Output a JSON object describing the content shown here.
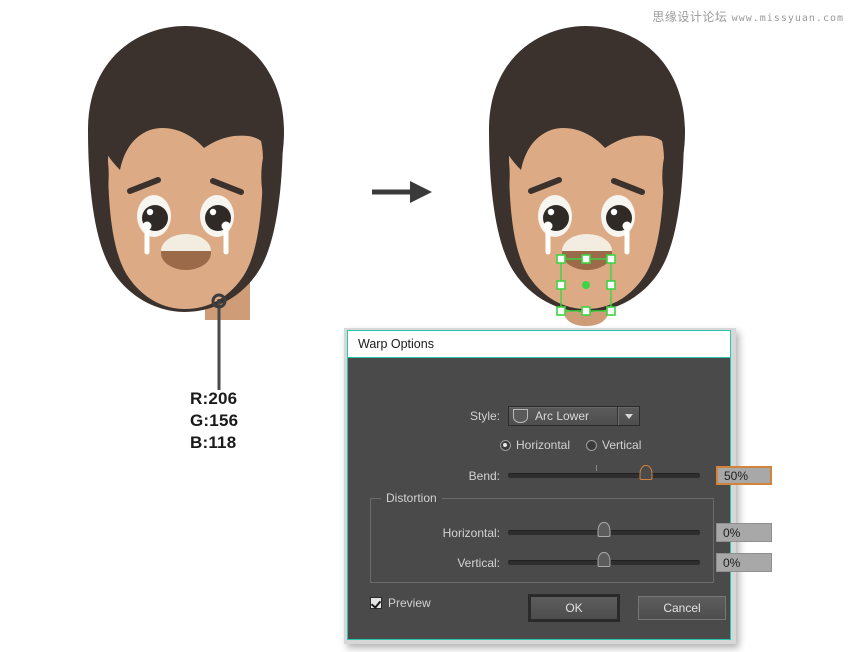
{
  "watermark": {
    "cn": "思缘设计论坛",
    "url": "www.missyuan.com"
  },
  "illustration": {
    "left_figure_name": "crying-boy-original",
    "right_figure_name": "crying-boy-warped",
    "arrow_name": "transform-arrow",
    "colors": {
      "hair": "#3b322e",
      "skin": "#dcab85",
      "neck": "#ce9c76",
      "mouth_lower": "#9a6a49",
      "mouth_upper": "#f2ece1",
      "eye_white": "#f7f5f0",
      "pupil": "#2f2a26",
      "tear": "#ffffff",
      "brow": "#3b322e",
      "selection": "#3ed442"
    }
  },
  "color_readout": {
    "r": "R:206",
    "g": "G:156",
    "b": "B:118"
  },
  "dialog": {
    "title": "Warp Options",
    "accent_border": "#28c6ab",
    "style": {
      "label": "Style:",
      "value": "Arc Lower",
      "icon": "arc-lower-icon"
    },
    "orientation": {
      "options": [
        {
          "label": "Horizontal",
          "selected": true
        },
        {
          "label": "Vertical",
          "selected": false
        }
      ]
    },
    "bend": {
      "label": "Bend:",
      "value": "50%",
      "slider_percent": 72,
      "tick_percent": 46
    },
    "distortion": {
      "group_label": "Distortion",
      "horizontal": {
        "label": "Horizontal:",
        "value": "0%",
        "slider_percent": 50
      },
      "vertical": {
        "label": "Vertical:",
        "value": "0%",
        "slider_percent": 50
      }
    },
    "preview": {
      "label": "Preview",
      "checked": true
    },
    "buttons": {
      "ok": "OK",
      "cancel": "Cancel"
    }
  }
}
